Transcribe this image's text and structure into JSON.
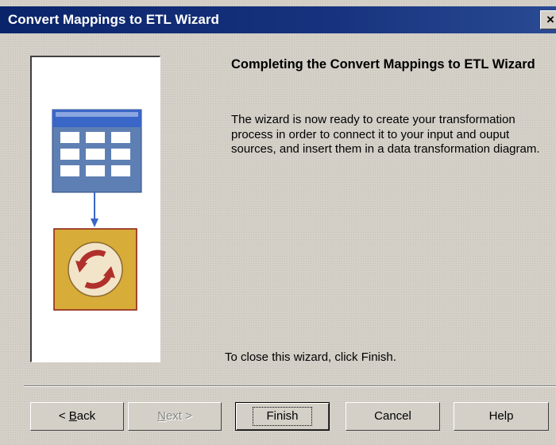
{
  "window": {
    "title": "Convert Mappings to ETL Wizard",
    "close_label": "×"
  },
  "content": {
    "title": "Completing the Convert Mappings to ETL Wizard",
    "description": "The wizard is now ready to create your transformation process in order to connect it to your input and ouput sources, and insert them in a data transformation diagram.",
    "close_hint": "To close this wizard, click Finish."
  },
  "buttons": {
    "back": {
      "prefix": "< ",
      "mnemonic": "B",
      "rest": "ack"
    },
    "next": {
      "mnemonic": "N",
      "rest": "ext >"
    },
    "finish": "Finish",
    "cancel": "Cancel",
    "help": "Help"
  },
  "illustration": {
    "icons": [
      "table-icon",
      "arrow-down-icon",
      "transformation-process-icon"
    ],
    "colors": {
      "table_header": "#3a66c8",
      "table_body": "#5e7fb3",
      "table_cell": "#ffffff",
      "arrow": "#3a66c8",
      "process_bg": "#d8ac38",
      "process_circle": "#f2e4c8",
      "process_arrows": "#b0302c",
      "titlebar": "#0a246a"
    }
  }
}
